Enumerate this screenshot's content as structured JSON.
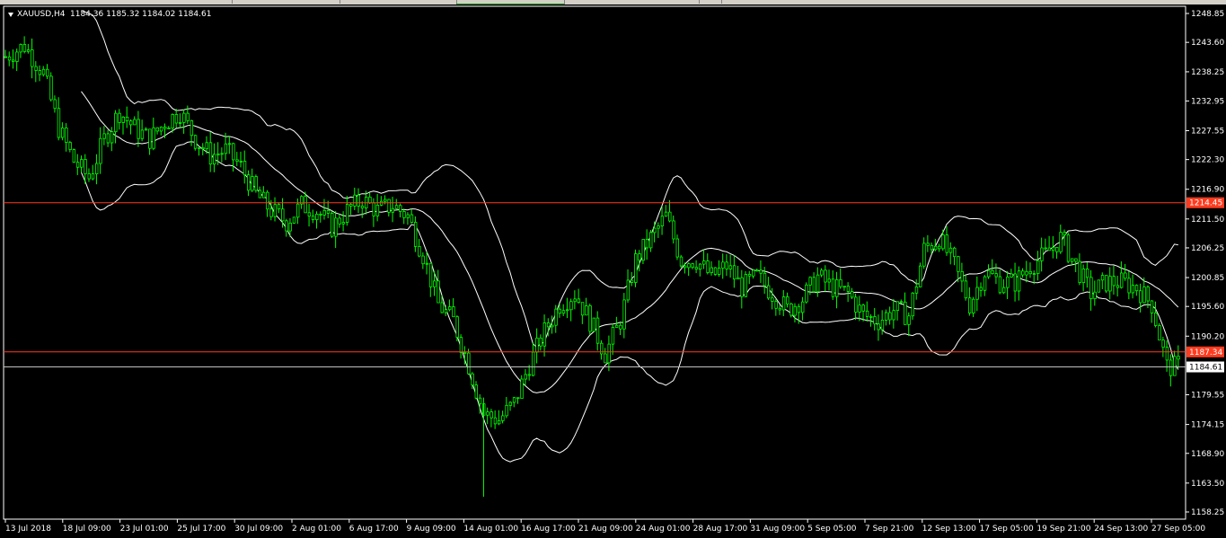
{
  "window": {
    "symbol_label": "XAUUSD,H4",
    "ohlc": "1184.36 1185.32 1184.02 1184.61"
  },
  "colors": {
    "background": "#000000",
    "candle": "#00ff00",
    "band": "#ffffff",
    "level_line": "#ff3b1f",
    "level_tag": "#ff3b1f",
    "price_line": "#c0c0c0",
    "axis_text": "#ffffff"
  },
  "chart_data": {
    "type": "candlestick",
    "instrument": "XAUUSD",
    "timeframe": "H4",
    "ylim": [
      1158.25,
      1248.85
    ],
    "y_ticks": [
      "1248.85",
      "1243.60",
      "1238.25",
      "1232.95",
      "1227.55",
      "1222.30",
      "1216.90",
      "1211.50",
      "1206.25",
      "1200.85",
      "1195.60",
      "1190.20",
      "1184.61",
      "1179.55",
      "1174.15",
      "1168.90",
      "1163.50",
      "1158.25"
    ],
    "x_ticks": [
      "13 Jul 2018",
      "18 Jul 09:00",
      "23 Jul 01:00",
      "25 Jul 17:00",
      "30 Jul 09:00",
      "2 Aug 01:00",
      "6 Aug 17:00",
      "9 Aug 09:00",
      "14 Aug 01:00",
      "16 Aug 17:00",
      "21 Aug 09:00",
      "24 Aug 01:00",
      "28 Aug 17:00",
      "31 Aug 09:00",
      "5 Sep 05:00",
      "7 Sep 21:00",
      "12 Sep 13:00",
      "17 Sep 05:00",
      "19 Sep 21:00",
      "24 Sep 13:00",
      "27 Sep 05:00"
    ],
    "horizontal_levels": [
      {
        "value": 1214.45,
        "label": "1214.45"
      },
      {
        "value": 1187.34,
        "label": "1187.34"
      }
    ],
    "current_price": {
      "value": 1184.61,
      "label": "1184.61"
    },
    "price_path": [
      [
        0,
        1241
      ],
      [
        5,
        1243
      ],
      [
        10,
        1238
      ],
      [
        14,
        1228
      ],
      [
        18,
        1222
      ],
      [
        22,
        1219
      ],
      [
        26,
        1226
      ],
      [
        30,
        1231
      ],
      [
        34,
        1228
      ],
      [
        38,
        1226
      ],
      [
        42,
        1229
      ],
      [
        46,
        1231
      ],
      [
        50,
        1226
      ],
      [
        54,
        1223
      ],
      [
        58,
        1224
      ],
      [
        62,
        1221
      ],
      [
        66,
        1216
      ],
      [
        70,
        1213
      ],
      [
        74,
        1211
      ],
      [
        78,
        1214
      ],
      [
        82,
        1213
      ],
      [
        86,
        1210
      ],
      [
        90,
        1213
      ],
      [
        94,
        1215
      ],
      [
        98,
        1213
      ],
      [
        102,
        1214
      ],
      [
        106,
        1212
      ],
      [
        110,
        1205
      ],
      [
        114,
        1196
      ],
      [
        118,
        1193
      ],
      [
        122,
        1185
      ],
      [
        126,
        1176
      ],
      [
        130,
        1175
      ],
      [
        134,
        1178
      ],
      [
        138,
        1185
      ],
      [
        142,
        1191
      ],
      [
        146,
        1196
      ],
      [
        150,
        1198
      ],
      [
        154,
        1193
      ],
      [
        158,
        1187
      ],
      [
        162,
        1193
      ],
      [
        166,
        1204
      ],
      [
        170,
        1208
      ],
      [
        174,
        1212
      ],
      [
        178,
        1204
      ],
      [
        182,
        1204
      ],
      [
        186,
        1201
      ],
      [
        190,
        1203
      ],
      [
        194,
        1199
      ],
      [
        198,
        1201
      ],
      [
        202,
        1198
      ],
      [
        206,
        1195
      ],
      [
        210,
        1197
      ],
      [
        214,
        1201
      ],
      [
        218,
        1199
      ],
      [
        222,
        1198
      ],
      [
        226,
        1194
      ],
      [
        230,
        1193
      ],
      [
        234,
        1195
      ],
      [
        238,
        1194
      ],
      [
        242,
        1206
      ],
      [
        246,
        1208
      ],
      [
        250,
        1203
      ],
      [
        254,
        1196
      ],
      [
        258,
        1202
      ],
      [
        262,
        1200
      ],
      [
        266,
        1200
      ],
      [
        270,
        1203
      ],
      [
        274,
        1205
      ],
      [
        278,
        1208
      ],
      [
        282,
        1203
      ],
      [
        286,
        1198
      ],
      [
        290,
        1200
      ],
      [
        294,
        1200
      ],
      [
        298,
        1199
      ],
      [
        302,
        1196
      ],
      [
        306,
        1184.61
      ]
    ]
  }
}
